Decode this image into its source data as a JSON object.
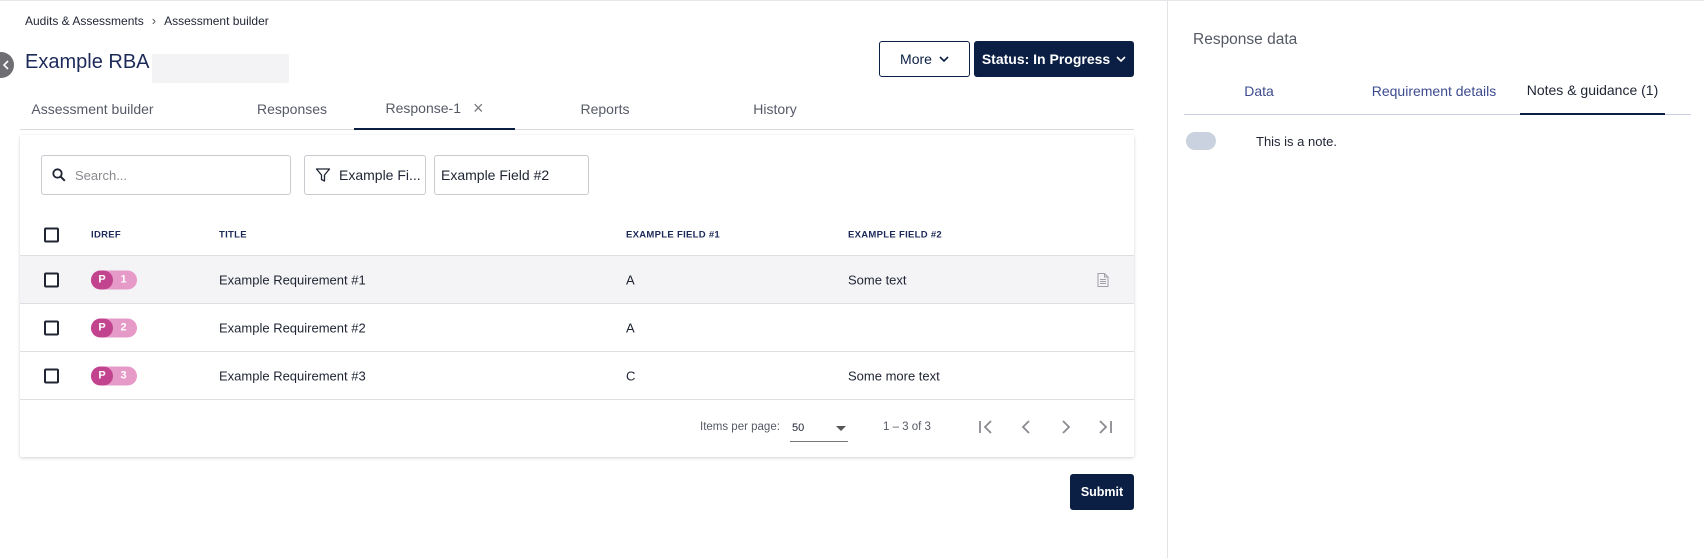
{
  "breadcrumb": {
    "item1": "Audits & Assessments",
    "item2": "Assessment builder"
  },
  "page": {
    "title": "Example RBA"
  },
  "header": {
    "more_label": "More",
    "status_label": "Status: In Progress"
  },
  "tabs": [
    {
      "label": "Assessment builder"
    },
    {
      "label": "Responses"
    },
    {
      "label": "Response-1"
    },
    {
      "label": "Reports"
    },
    {
      "label": "History"
    }
  ],
  "toolbar": {
    "search_placeholder": "Search...",
    "filter_label": "Example Fi...",
    "field_value": "Example Field #2"
  },
  "table": {
    "columns": {
      "idref": "IDREF",
      "title": "TITLE",
      "field1": "EXAMPLE FIELD #1",
      "field2": "EXAMPLE FIELD #2"
    },
    "rows": [
      {
        "prefix": "P",
        "num": "1",
        "title": "Example Requirement #1",
        "field1": "A",
        "field2": "Some text"
      },
      {
        "prefix": "P",
        "num": "2",
        "title": "Example Requirement #2",
        "field1": "A",
        "field2": ""
      },
      {
        "prefix": "P",
        "num": "3",
        "title": "Example Requirement #3",
        "field1": "C",
        "field2": "Some more text"
      }
    ]
  },
  "pager": {
    "items_per_page_label": "Items per page:",
    "items_per_page": "50",
    "range": "1 – 3 of 3"
  },
  "submit_label": "Submit",
  "panel": {
    "title": "Response data",
    "tabs": [
      {
        "label": "Data"
      },
      {
        "label": "Requirement details"
      },
      {
        "label": "Notes & guidance (1)"
      }
    ],
    "note": "This is a note."
  },
  "colors": {
    "primary": "#0b1f44",
    "badge_dark": "#c2448f",
    "badge_light": "#e69ac7",
    "link": "#3d4b8f"
  }
}
